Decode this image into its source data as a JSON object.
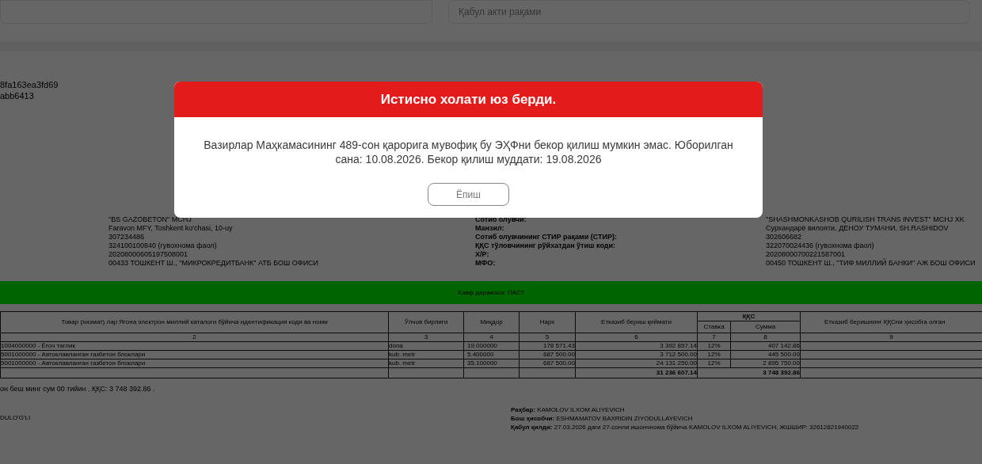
{
  "filters": {
    "act_number_placeholder": "Қабул акти рақами"
  },
  "document": {
    "ids": [
      "8fa163ea3fd69",
      "abb6413"
    ],
    "seller": [
      "\"BS GAZOBETON\" MCHJ",
      "Faravon MFY, Toshkent ko'chasi, 10-uy",
      "307234486",
      "324100100840 (гувохнома фаол)",
      "20208000605197508001",
      "00433 ТОШКЕНТ Ш., \"МИКРОКРЕДИТБАНК\" АТБ БОШ ОФИСИ"
    ],
    "buyer_labels": [
      "Сотиб олувчи:",
      "Манзил:",
      "Сотиб олувчининг СТИР рақами (СТИР):",
      "ҚҚС тўловчининг рўйхатдан ўтиш коди:",
      "Х/Р:",
      "МФО:"
    ],
    "buyer_values": [
      "\"SHASHMONKASHOB QURILISH TRANS INVEST\" MCHJ XK",
      "Сурхандарё вилояти, ДЕНОУ ТУМАНИ, SH.RASHIDOV",
      "302606682",
      "322070024436 (гувохнома фаол)",
      "20208000700221587001",
      "00450 ТОШКЕНТ Ш., \"ТИФ МИЛЛИЙ БАНКИ\" АЖ БОШ ОФИСИ"
    ],
    "risk_banner": "Хавф даражаси: ПАСТ",
    "table": {
      "columns": [
        {
          "label": "Товар (хизмат) лар Ягона электрон миллий каталоги бўйича идентификация коди ва номи",
          "number": "2",
          "kind": "main"
        },
        {
          "label": "Ўлчов бирлиги",
          "number": "3",
          "kind": "main"
        },
        {
          "label": "Миқдор",
          "number": "4",
          "kind": "main"
        },
        {
          "label": "Нарх",
          "number": "5",
          "kind": "main"
        },
        {
          "label": "Етказиб бериш қиймати",
          "number": "6",
          "kind": "main"
        },
        {
          "label": "Ставка",
          "number": "7",
          "kind": "sub"
        },
        {
          "label": "Сумма",
          "number": "8",
          "kind": "sub"
        },
        {
          "label": "Етказиб беришнинг ҚҚСни ҳисобга олган",
          "number": "9",
          "kind": "main"
        }
      ],
      "group_label": "ҚҚС",
      "rows": [
        [
          "1004000000 - Ёғоч таглик",
          "dona",
          "19.000000",
          "178 571.43",
          "3 392 857.14",
          "12%",
          "407 142.86"
        ],
        [
          "5001000000 - Автоклавланган газбетон блоклари",
          "kub. metr",
          "5.400000",
          "687 500.00",
          "3 712 500.00",
          "12%",
          "445 500.00"
        ],
        [
          "5001000000 - Автоклавланган газбетон блоклари",
          "kub. metr",
          "35.100000",
          "687 500.00",
          "24 131 250.00",
          "12%",
          "2 895 750.00"
        ]
      ],
      "totals": {
        "cost": "31 236 607.14",
        "vat": "3 748 392.86"
      }
    },
    "total_words": "он беш минг сум 00 тийин . ҚҚС: 3 748 392.86 .",
    "left_signer": "DULO'G'LI",
    "signatures": [
      {
        "label": "Раҳбар:",
        "value": "KAMOLOV ILXOM ALIYEVICH"
      },
      {
        "label": "Бош ҳисобчи:",
        "value": "ESHMAMATOV BAXRIDIN ZIYODULLAYEVICH"
      },
      {
        "label": "Қабул қилди:",
        "value": "27.03.2026 даги 27-сонли ишончнома бўйича KAMOLOV ILXOM ALIYEVICH, ЖШШИР: 32612821940022"
      }
    ]
  },
  "dialog": {
    "title": "Истисно холати юз берди.",
    "message": "Вазирлар Маҳкамасининг 489-сон қарорига мувофиқ бу ЭҲФни бекор қилиш мумкин эмас. Юборилган сана: 10.08.2026. Бекор қилиш муддати: 19.08.2026",
    "button": "Ёпиш"
  }
}
